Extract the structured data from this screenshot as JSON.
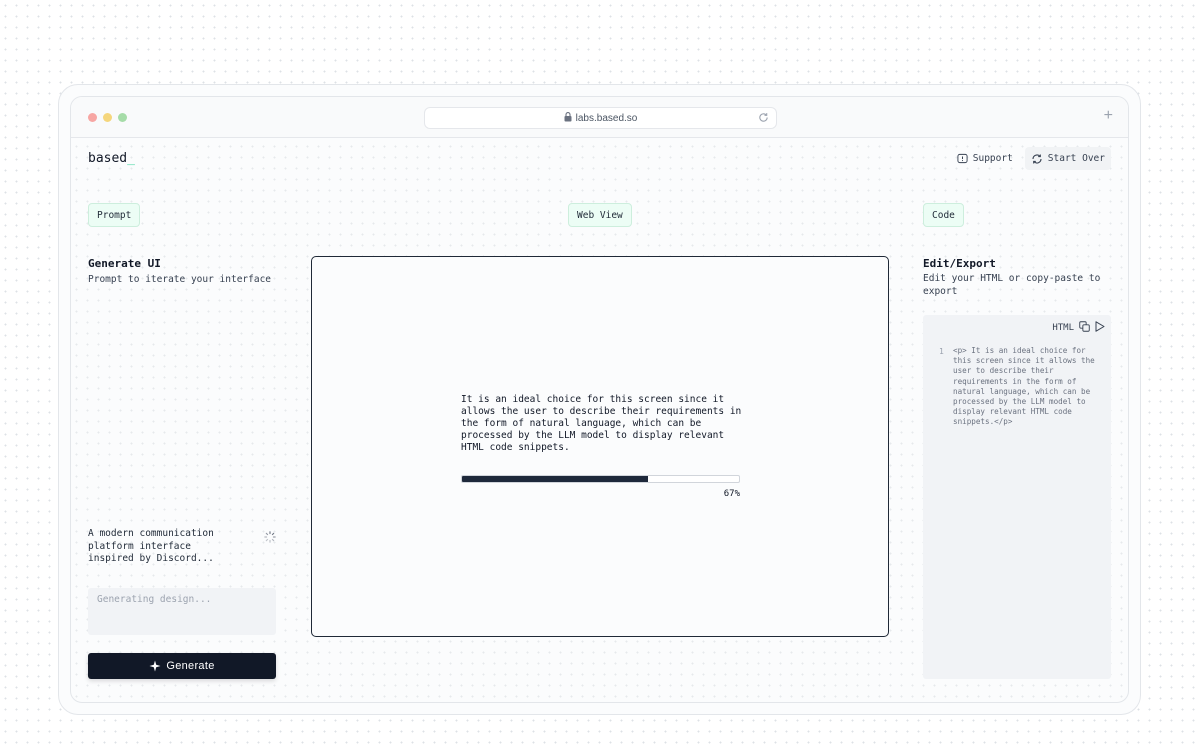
{
  "browser": {
    "url": "labs.based.so"
  },
  "app": {
    "logo_text": "based",
    "logo_cursor": "_",
    "actions": {
      "support": "Support",
      "start_over": "Start Over"
    }
  },
  "tabs": {
    "prompt": "Prompt",
    "web_view": "Web View",
    "code": "Code"
  },
  "prompt_panel": {
    "title": "Generate UI",
    "subtitle": "Prompt to iterate your interface",
    "message": "A modern communication platform interface inspired by Discord...",
    "input_placeholder": "Generating design...",
    "generate_label": "Generate"
  },
  "web_view": {
    "text": "It is an ideal choice for this screen since it allows the user to describe their requirements in the form of natural language, which can be processed by the LLM model to display relevant HTML code snippets.",
    "progress": 67,
    "progress_label": "67%"
  },
  "code_panel": {
    "title": "Edit/Export",
    "subtitle": "Edit your HTML or copy-paste to export",
    "language": "HTML",
    "line_number": "1",
    "code": "<p> It is an ideal choice for this screen since it allows the user to describe their requirements in the form of natural language, which can be processed by the LLM model to display relevant HTML code snippets.</p>"
  },
  "colors": {
    "accent_green": "#34d399",
    "tag_bg": "#ecfdf5",
    "primary_dark": "#111827",
    "progress_fill": "#1e293b"
  },
  "icons": [
    "lock-icon",
    "reload-icon",
    "plus-icon",
    "support-icon",
    "refresh-icon",
    "spinner-icon",
    "sparkle-icon",
    "copy-icon",
    "play-icon"
  ]
}
